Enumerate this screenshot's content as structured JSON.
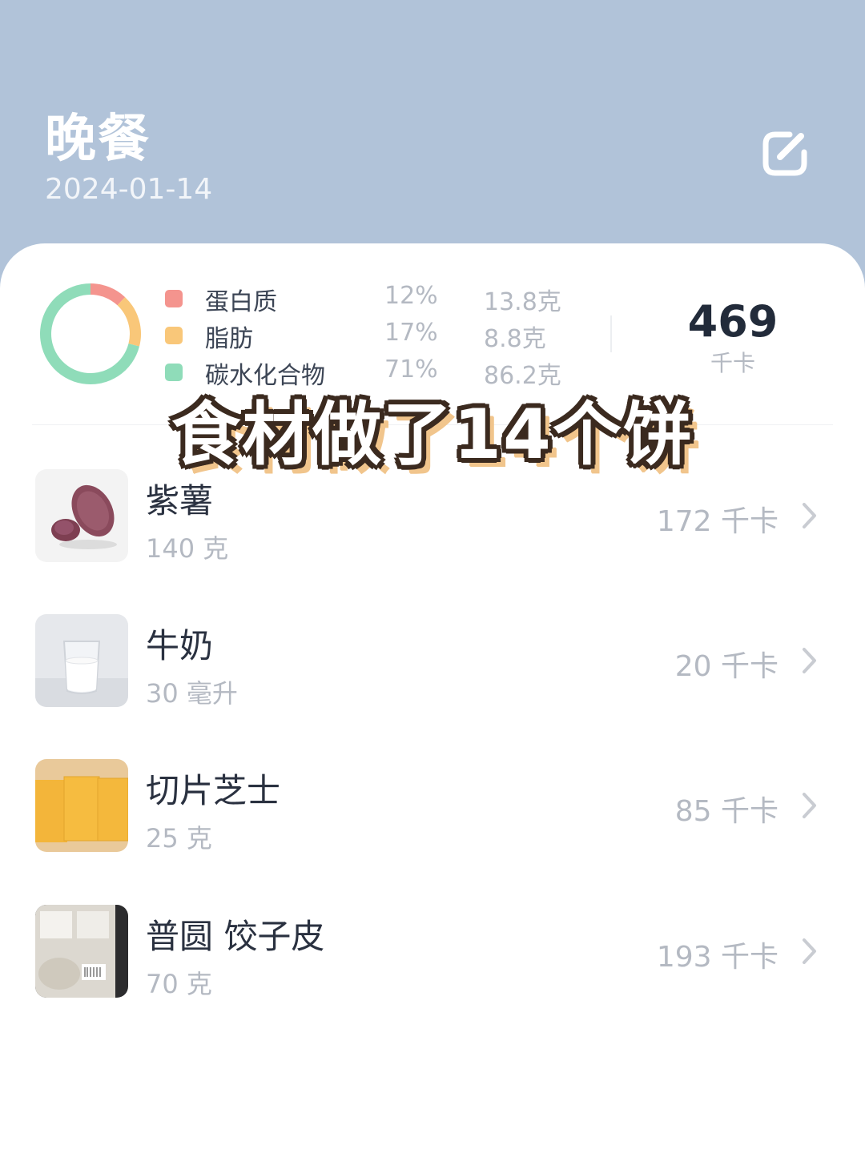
{
  "header": {
    "title": "晚餐",
    "date": "2024-01-14",
    "edit_icon": "edit-icon"
  },
  "summary": {
    "macros": [
      {
        "name": "蛋白质",
        "percent": "12%",
        "amount": "13.8克",
        "color": "#f4948e",
        "share": 12
      },
      {
        "name": "脂肪",
        "percent": "17%",
        "amount": "8.8克",
        "color": "#f9c779",
        "share": 17
      },
      {
        "name": "碳水化合物",
        "percent": "71%",
        "amount": "86.2克",
        "color": "#8fdcb9",
        "share": 71
      }
    ],
    "calories": "469",
    "calories_unit": "千卡"
  },
  "overlay_text": "食材做了14个饼",
  "foods": [
    {
      "name": "紫薯",
      "quantity": "140 克",
      "calories": "172 千卡",
      "icon": "purple-sweet-potato-image"
    },
    {
      "name": "牛奶",
      "quantity": "30 毫升",
      "calories": "20 千卡",
      "icon": "milk-glass-image"
    },
    {
      "name": "切片芝士",
      "quantity": "25 克",
      "calories": "85 千卡",
      "icon": "cheese-slice-image"
    },
    {
      "name": "普圆 饺子皮",
      "quantity": "70 克",
      "calories": "193 千卡",
      "icon": "dumpling-wrapper-package-image"
    }
  ],
  "colors": {
    "header_bg": "#b1c3d9",
    "card_bg": "#ffffff",
    "protein": "#f4948e",
    "fat": "#f9c779",
    "carbs": "#8fdcb9"
  }
}
